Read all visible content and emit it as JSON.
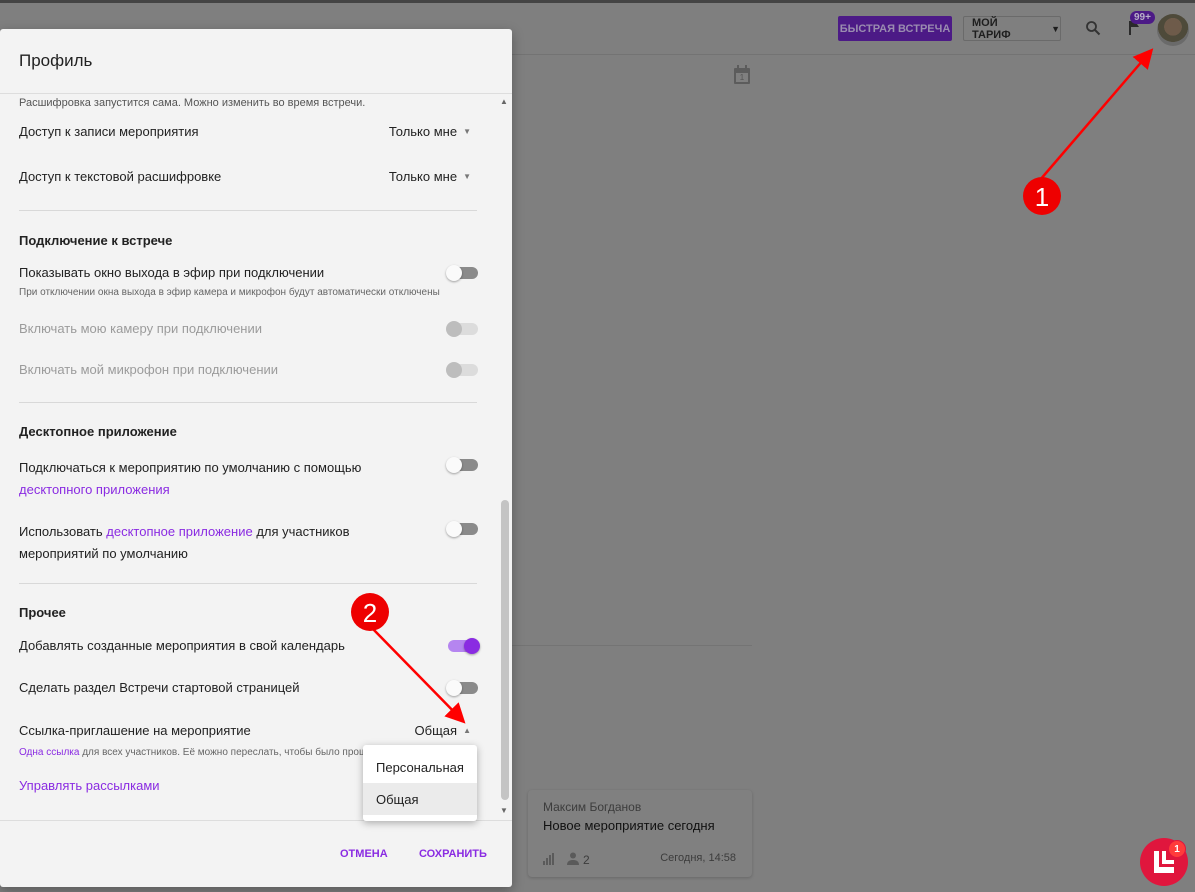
{
  "header": {
    "quick_meeting": "БЫСТРАЯ ВСТРЕЧА",
    "tariff": "МОЙ ТАРИФ",
    "notifications_badge": "99+",
    "calendar_day": "1"
  },
  "card": {
    "author": "Максим Богданов",
    "title": "Новое мероприятие сегодня",
    "participants": "2",
    "date": "Сегодня, 14:58"
  },
  "chat_badge": "1",
  "modal": {
    "title": "Профиль",
    "partial_hint": "Расшифровка запустится сама. Можно изменить во время встречи.",
    "record_access": {
      "label": "Доступ к записи мероприятия",
      "value": "Только мне"
    },
    "transcript_access": {
      "label": "Доступ к текстовой расшифровке",
      "value": "Только мне"
    },
    "connection": {
      "heading": "Подключение к встрече",
      "show_window": {
        "label": "Показывать окно выхода в эфир при подключении",
        "hint": "При отключении окна выхода в эфир камера и микрофон будут автоматически отключены",
        "on": false
      },
      "camera": {
        "label": "Включать мою камеру при подключении",
        "on": false,
        "disabled": true
      },
      "mic": {
        "label": "Включать мой микрофон при подключении",
        "on": false,
        "disabled": true
      }
    },
    "desktop": {
      "heading": "Десктопное приложение",
      "default_connect": {
        "label": "Подключаться к мероприятию по умолчанию с помощью",
        "link": "десктопного приложения",
        "on": false
      },
      "use_for_participants": {
        "prefix": "Использовать ",
        "link": "десктопное приложение",
        "suffix": " для участников",
        "line2": "мероприятий по умолчанию",
        "on": false
      }
    },
    "other": {
      "heading": "Прочее",
      "add_to_calendar": {
        "label": "Добавлять созданные мероприятия в свой календарь",
        "on": true
      },
      "start_page": {
        "label": "Сделать раздел Встречи стартовой страницей",
        "on": false
      },
      "invite_link": {
        "label": "Ссылка-приглашение на мероприятие",
        "value": "Общая",
        "hint_link": "Одна ссылка",
        "hint": " для всех участников. Её можно переслать, чтобы было проще"
      },
      "manage_mailings": "Управлять рассылками"
    },
    "dropdown": {
      "options": [
        "Персональная",
        "Общая"
      ],
      "selected": "Общая"
    },
    "cancel": "ОТМЕНА",
    "save": "СОХРАНИТЬ"
  },
  "annotations": {
    "first": "1",
    "second": "2"
  }
}
